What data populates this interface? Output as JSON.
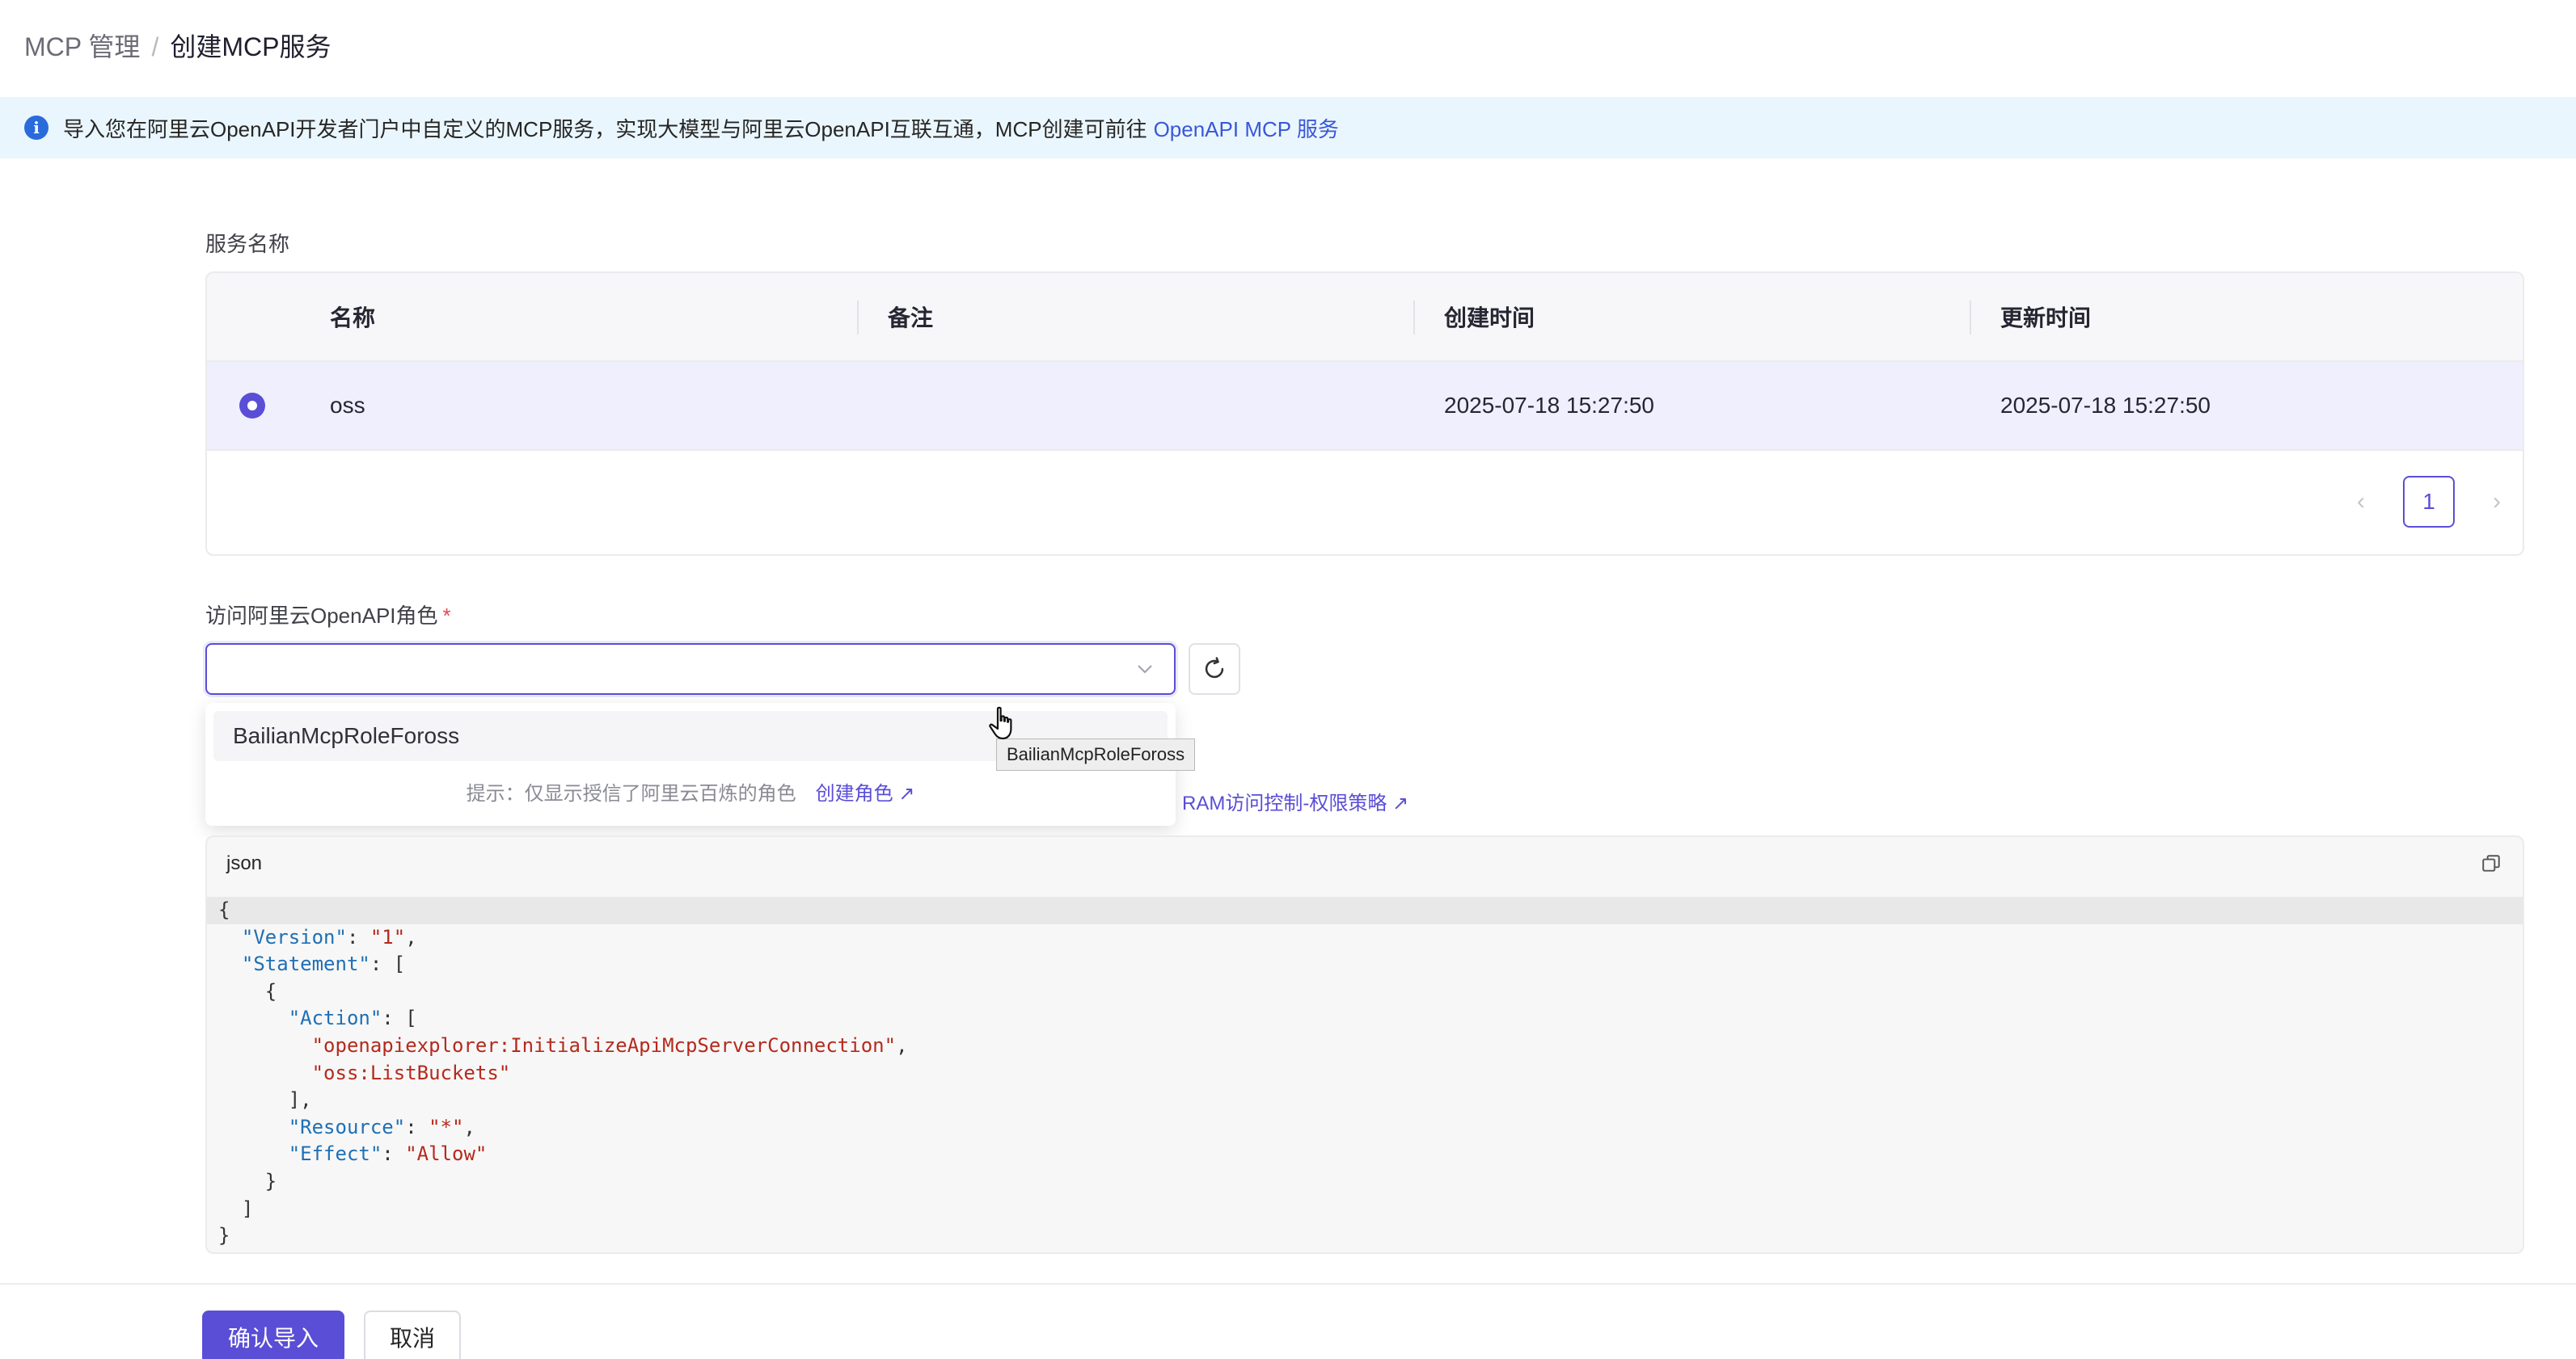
{
  "breadcrumb": {
    "parent": "MCP 管理",
    "separator": "/",
    "current": "创建MCP服务"
  },
  "banner": {
    "text": "导入您在阿里云OpenAPI开发者门户中自定义的MCP服务，实现大模型与阿里云OpenAPI互联互通，MCP创建可前往",
    "link": "OpenAPI MCP 服务",
    "icon": "info-icon"
  },
  "service": {
    "label": "服务名称",
    "columns": [
      "名称",
      "备注",
      "创建时间",
      "更新时间"
    ],
    "rows": [
      {
        "name": "oss",
        "remark": "",
        "created": "2025-07-18 15:27:50",
        "updated": "2025-07-18 15:27:50",
        "selected": true
      }
    ],
    "pagination": {
      "current": "1",
      "prev": "‹",
      "next": "›"
    }
  },
  "role": {
    "label": "访问阿里云OpenAPI角色",
    "required": "*",
    "value": "",
    "options": [
      "BailianMcpRoleFoross"
    ],
    "tip": "提示：仅显示授信了阿里云百炼的角色",
    "create_link": "创建角色 ↗",
    "tooltip": "BailianMcpRoleFoross"
  },
  "ram_link": "RAM访问控制-权限策略 ↗",
  "code": {
    "lang": "json",
    "lines": [
      "{",
      "  \"Version\": \"1\",",
      "  \"Statement\": [",
      "    {",
      "      \"Action\": [",
      "        \"openapiexplorer:InitializeApiMcpServerConnection\",",
      "        \"oss:ListBuckets\"",
      "      ],",
      "      \"Resource\": \"*\",",
      "      \"Effect\": \"Allow\"",
      "    }",
      "  ]",
      "}"
    ]
  },
  "actions": {
    "confirm": "确认导入",
    "cancel": "取消"
  },
  "colors": {
    "primary": "#5a4ed6",
    "banner_bg": "#eaf6fd",
    "json_key": "#1f6fb5",
    "json_string": "#b52a1d"
  }
}
